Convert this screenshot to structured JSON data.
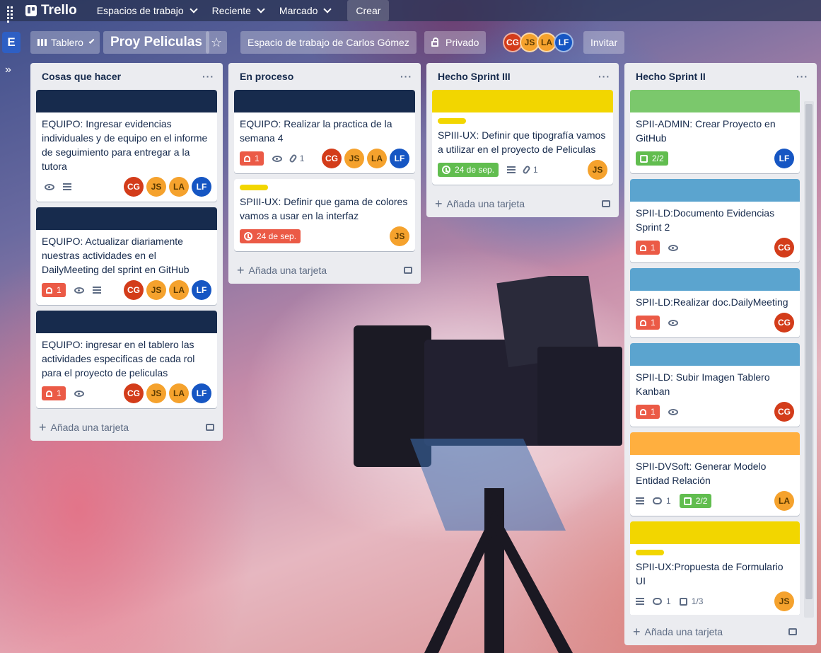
{
  "topbar": {
    "logo": "Trello",
    "nav": [
      "Espacios de trabajo",
      "Reciente",
      "Marcado"
    ],
    "create": "Crear"
  },
  "board": {
    "workspace_badge": "E",
    "view": "Tablero",
    "title": "Proy Peliculas",
    "workspace": "Espacio de trabajo de Carlos Gómez",
    "visibility": "Privado",
    "members": [
      "CG",
      "JS",
      "LA",
      "LF"
    ],
    "invite": "Invitar"
  },
  "add_card_label": "Añada una tarjeta",
  "colors": {
    "navy": "#172b4d",
    "yellow": "#f2d600",
    "green": "#7bc86c",
    "blue": "#5ba4cf",
    "orange": "#ffaf3f",
    "salmon": "#ef7564"
  },
  "lists": [
    {
      "title": "Cosas que hacer",
      "cards": [
        {
          "title": "EQUIPO: Ingresar evidencias individuales y de equipo en el informe de seguimiento para entregar a la tutora",
          "notif": "",
          "attach": "",
          "members": [
            "CG",
            "JS",
            "LA",
            "LF"
          ]
        },
        {
          "title": "EQUIPO: Actualizar diariamente nuestras actividades en el DailyMeeting del sprint en GitHub",
          "notif": "1",
          "members": [
            "CG",
            "JS",
            "LA",
            "LF"
          ]
        },
        {
          "title": "EQUIPO: ingresar en el tablero las actividades especificas de cada rol para el proyecto de peliculas",
          "notif": "1",
          "members": [
            "CG",
            "JS",
            "LA",
            "LF"
          ]
        }
      ]
    },
    {
      "title": "En proceso",
      "cards": [
        {
          "title": "EQUIPO: Realizar la practica de la semana 4",
          "notif": "1",
          "attach": "1",
          "members": [
            "CG",
            "JS",
            "LA",
            "LF"
          ]
        },
        {
          "title": "SPIII-UX: Definir que gama de colores vamos a usar en la interfaz",
          "due": "24 de sep.",
          "members": [
            "JS"
          ]
        }
      ]
    },
    {
      "title": "Hecho Sprint III",
      "cards": [
        {
          "title": "SPIII-UX: Definir que tipografía vamos a utilizar en el proyecto de Peliculas",
          "due": "24 de sep.",
          "attach": "1",
          "members": [
            "JS"
          ]
        }
      ]
    },
    {
      "title": "Hecho Sprint II",
      "cards": [
        {
          "title": "SPII-ADMIN: Crear Proyecto en GitHub",
          "checklist": "2/2",
          "members": [
            "LF"
          ]
        },
        {
          "title": "SPII-LD:Documento Evidencias Sprint 2",
          "notif": "1",
          "members": [
            "CG"
          ]
        },
        {
          "title": "SPII-LD:Realizar doc.DailyMeeting",
          "notif": "1",
          "members": [
            "CG"
          ]
        },
        {
          "title": "SPII-LD: Subir Imagen Tablero Kanban",
          "notif": "1",
          "members": [
            "CG"
          ]
        },
        {
          "title": "SPII-DVSoft: Generar Modelo Entidad Relación",
          "comments": "1",
          "checklist": "2/2",
          "members": [
            "LA"
          ]
        },
        {
          "title": "SPII-UX:Propuesta de Formulario UI",
          "comments": "1",
          "checklist": "1/3",
          "members": [
            "JS"
          ]
        }
      ]
    }
  ]
}
